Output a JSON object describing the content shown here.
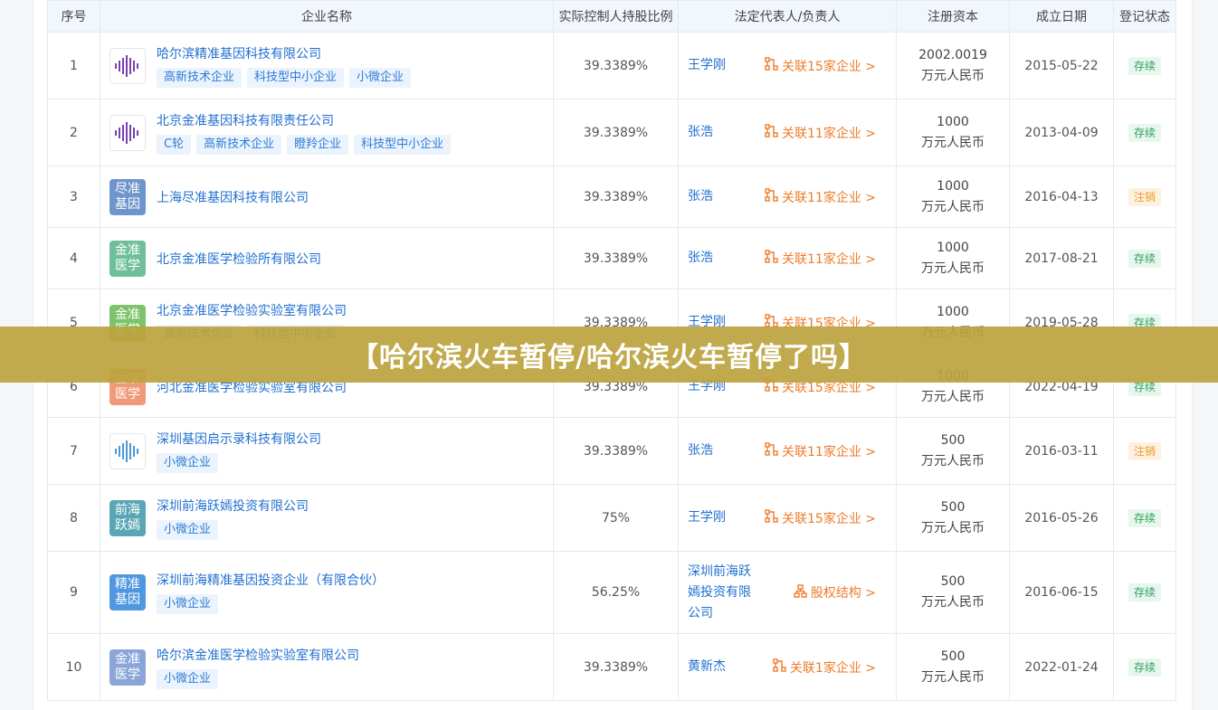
{
  "table": {
    "headers": [
      "序号",
      "企业名称",
      "实际控制人持股比例",
      "法定代表人/负责人",
      "注册资本",
      "成立日期",
      "登记状态"
    ],
    "rows": [
      {
        "no": "1",
        "name": "哈尔滨精准基因科技有限公司",
        "tags": [
          "高新技术企业",
          "科技型中小企业",
          "小微企业"
        ],
        "logo": {
          "type": "image",
          "color": "#7a3fb0",
          "text": ""
        },
        "ratio": "39.3389%",
        "person": [
          "王学刚"
        ],
        "relation": {
          "icon": "relation",
          "text": "关联15家企业 >"
        },
        "capital": [
          "2002.0019",
          "万元人民币"
        ],
        "date": "2015-05-22",
        "status": "存续",
        "status_color": "green"
      },
      {
        "no": "2",
        "name": "北京金准基因科技有限责任公司",
        "tags": [
          "C轮",
          "高新技术企业",
          "瞪羚企业",
          "科技型中小企业"
        ],
        "logo": {
          "type": "image",
          "color": "#7a3fb0",
          "text": ""
        },
        "ratio": "39.3389%",
        "person": [
          "张浩"
        ],
        "relation": {
          "icon": "relation",
          "text": "关联11家企业 >"
        },
        "capital": [
          "1000",
          "万元人民币"
        ],
        "date": "2013-04-09",
        "status": "存续",
        "status_color": "green"
      },
      {
        "no": "3",
        "name": "上海尽准基因科技有限公司",
        "tags": [],
        "logo": {
          "type": "text",
          "color": "#6e96cc",
          "text": "尽准基因"
        },
        "ratio": "39.3389%",
        "person": [
          "张浩"
        ],
        "relation": {
          "icon": "relation",
          "text": "关联11家企业 >"
        },
        "capital": [
          "1000",
          "万元人民币"
        ],
        "date": "2016-04-13",
        "status": "注销",
        "status_color": "orange"
      },
      {
        "no": "4",
        "name": "北京金准医学检验所有限公司",
        "tags": [],
        "logo": {
          "type": "text",
          "color": "#6fbf9c",
          "text": "金准医学"
        },
        "ratio": "39.3389%",
        "person": [
          "张浩"
        ],
        "relation": {
          "icon": "relation",
          "text": "关联11家企业 >"
        },
        "capital": [
          "1000",
          "万元人民币"
        ],
        "date": "2017-08-21",
        "status": "存续",
        "status_color": "green"
      },
      {
        "no": "5",
        "name": "北京金准医学检验实验室有限公司",
        "tags": [
          "高新技术企业",
          "科技型中小企业"
        ],
        "logo": {
          "type": "text",
          "color": "#7cc36a",
          "text": "金准医学"
        },
        "ratio": "39.3389%",
        "person": [
          "王学刚"
        ],
        "relation": {
          "icon": "relation",
          "text": "关联15家企业 >"
        },
        "capital": [
          "1000",
          "万元人民币"
        ],
        "date": "2019-05-28",
        "status": "存续",
        "status_color": "green"
      },
      {
        "no": "6",
        "name": "河北金准医学检验实验室有限公司",
        "tags": [],
        "logo": {
          "type": "text",
          "color": "#ef9a78",
          "text": "金准医学"
        },
        "ratio": "39.3389%",
        "person": [
          "王学刚"
        ],
        "relation": {
          "icon": "relation",
          "text": "关联15家企业 >"
        },
        "capital": [
          "1000",
          "万元人民币"
        ],
        "date": "2022-04-19",
        "status": "存续",
        "status_color": "green"
      },
      {
        "no": "7",
        "name": "深圳基因启示录科技有限公司",
        "tags": [
          "小微企业"
        ],
        "logo": {
          "type": "image",
          "color": "#4a9ad6",
          "text": ""
        },
        "ratio": "39.3389%",
        "person": [
          "张浩"
        ],
        "relation": {
          "icon": "relation",
          "text": "关联11家企业 >"
        },
        "capital": [
          "500",
          "万元人民币"
        ],
        "date": "2016-03-11",
        "status": "注销",
        "status_color": "orange"
      },
      {
        "no": "8",
        "name": "深圳前海跃嫣投资有限公司",
        "tags": [
          "小微企业"
        ],
        "logo": {
          "type": "text",
          "color": "#5aa6b5",
          "text": "前海跃嫣"
        },
        "ratio": "75%",
        "person": [
          "王学刚"
        ],
        "relation": {
          "icon": "relation",
          "text": "关联15家企业 >"
        },
        "capital": [
          "500",
          "万元人民币"
        ],
        "date": "2016-05-26",
        "status": "存续",
        "status_color": "green"
      },
      {
        "no": "9",
        "name": "深圳前海精准基因投资企业（有限合伙）",
        "tags": [
          "小微企业"
        ],
        "logo": {
          "type": "text",
          "color": "#4f98e0",
          "text": "精准基因"
        },
        "ratio": "56.25%",
        "person": [
          "深圳前海跃",
          "嫣投资有限",
          "公司"
        ],
        "relation": {
          "icon": "structure",
          "text": "股权结构 >"
        },
        "capital": [
          "500",
          "万元人民币"
        ],
        "date": "2016-06-15",
        "status": "存续",
        "status_color": "green"
      },
      {
        "no": "10",
        "name": "哈尔滨金准医学检验实验室有限公司",
        "tags": [
          "小微企业"
        ],
        "logo": {
          "type": "text",
          "color": "#8aa6d8",
          "text": "金准医学"
        },
        "ratio": "39.3389%",
        "person": [
          "黄新杰"
        ],
        "relation": {
          "icon": "relation",
          "text": "关联1家企业 >"
        },
        "capital": [
          "500",
          "万元人民币"
        ],
        "date": "2022-01-24",
        "status": "存续",
        "status_color": "green"
      }
    ]
  },
  "banner": {
    "text": "【哈尔滨火车暂停/哈尔滨火车暂停了吗】"
  },
  "colors": {
    "link": "#1f6fd0",
    "relation": "#ee7b2b",
    "banner": "#bca33e"
  }
}
